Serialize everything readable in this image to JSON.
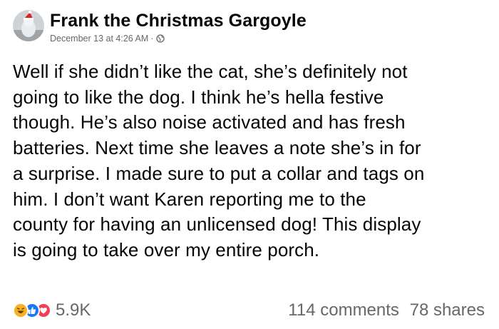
{
  "post": {
    "author": "Frank the Christmas Gargoyle",
    "timestamp": "December 13 at 4:26 AM",
    "separator": "·",
    "privacy_icon": "globe-icon",
    "text": "Well if she didn’t like the cat, she’s definitely not\ngoing to like the dog.  I think he’s hella festive\nthough.  He’s also noise activated and has fresh\nbatteries.  Next time she leaves a note she’s in for\na surprise.  I made sure to put a collar and tags on\nhim. I don’t want Karen reporting me to the\ncounty for having an unlicensed dog!  This display\nis going to take over my entire porch."
  },
  "reactions": {
    "icons": [
      "haha-icon",
      "like-icon",
      "love-icon"
    ],
    "count": "5.9K"
  },
  "stats": {
    "comments": "114 comments",
    "shares": "78 shares"
  },
  "colors": {
    "text": "#050505",
    "secondary": "#65676b",
    "like_blue": "#1877f2",
    "love_red": "#f33e58",
    "haha_yellow": "#f7b125"
  }
}
